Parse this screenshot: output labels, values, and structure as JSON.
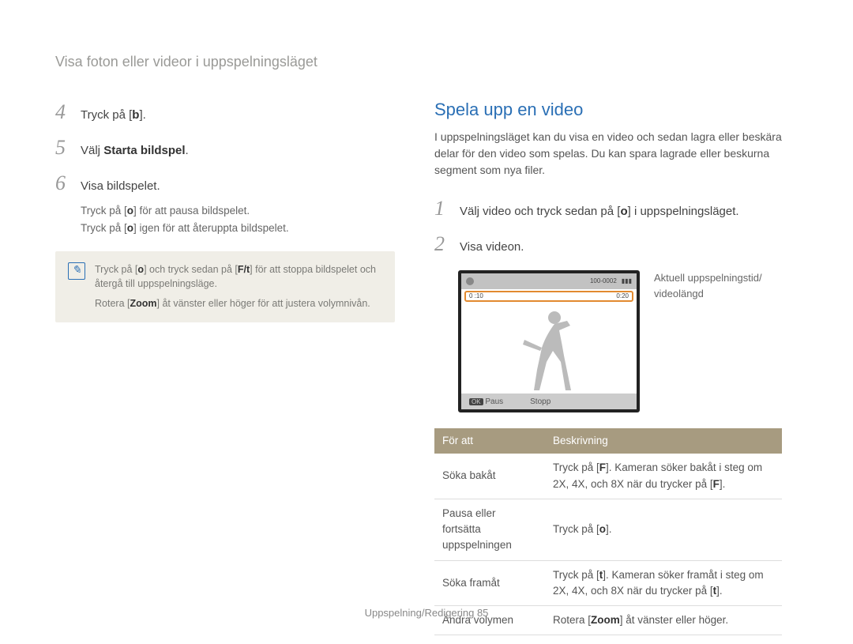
{
  "breadcrumb": "Visa foton eller videor i uppspelningsläget",
  "left": {
    "step4_num": "4",
    "step4_text_pre": "Tryck på [",
    "step4_key": "b",
    "step4_text_post": "].",
    "step5_num": "5",
    "step5_text_pre": "Välj ",
    "step5_bold": "Starta bildspel",
    "step5_text_post": ".",
    "step6_num": "6",
    "step6_text": "Visa bildspelet.",
    "sub1_pre": "Tryck på [",
    "sub1_key": "o",
    "sub1_post": "] för att pausa bildspelet.",
    "sub2_pre": "Tryck på [",
    "sub2_key": "o",
    "sub2_post": "] igen för att återuppta bildspelet.",
    "info1_pre": "Tryck på [",
    "info1_key1": "o",
    "info1_mid": "] och tryck sedan på [",
    "info1_key2": "F/t",
    "info1_post": "] för att stoppa bildspelet och återgå till uppspelningsläge.",
    "info2_pre": "Rotera [",
    "info2_key": "Zoom",
    "info2_post": "] åt vänster eller höger för att justera volymnivån."
  },
  "right": {
    "heading": "Spela upp en video",
    "intro": "I uppspelningsläget kan du visa en video och sedan lagra eller beskära delar för den video som spelas. Du kan spara lagrade eller beskurna segment som nya filer.",
    "step1_num": "1",
    "step1_pre": "Välj video och tryck sedan på [",
    "step1_key": "o",
    "step1_post": "] i uppspelningsläget.",
    "step2_num": "2",
    "step2_text": "Visa videon.",
    "screen": {
      "top_counter": "100-0002",
      "time_current": "0 :10",
      "time_total": "0:20",
      "ok": "OK",
      "paus": "Paus",
      "stopp": "Stopp"
    },
    "callout_line1": "Aktuell uppspelningstid/",
    "callout_line2": "videolängd",
    "table": {
      "th1": "För att",
      "th2": "Beskrivning",
      "r1c1": "Söka bakåt",
      "r1c2_pre": "Tryck på [",
      "r1c2_key": "F",
      "r1c2_mid": "]. Kameran söker bakåt i steg om 2X, 4X, och 8X när du trycker på [",
      "r1c2_key2": "F",
      "r1c2_post": "].",
      "r2c1": "Pausa eller fortsätta uppspelningen",
      "r2c2_pre": "Tryck på [",
      "r2c2_key": "o",
      "r2c2_post": "].",
      "r3c1": "Söka framåt",
      "r3c2_pre": "Tryck på [",
      "r3c2_key": "t",
      "r3c2_mid": "]. Kameran söker framåt i steg om 2X, 4X, och 8X när du trycker på [",
      "r3c2_key2": "t",
      "r3c2_post": "].",
      "r4c1": "Ändra volymen",
      "r4c2_pre": "Rotera [",
      "r4c2_key": "Zoom",
      "r4c2_post": "] åt vänster eller höger."
    }
  },
  "footer_pre": "Uppspelning/Redigering  ",
  "footer_page": "85"
}
